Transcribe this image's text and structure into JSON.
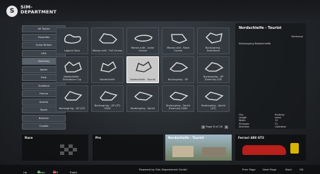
{
  "header": {
    "logo_letter": "S",
    "brand_line1": "SIM-",
    "brand_line2": "DEPARTMENT"
  },
  "nav": {
    "items": [
      "All Tracks",
      "Favorites",
      "Great Britain",
      "USA",
      "Germany",
      "Japan",
      "Italy",
      "Scotland",
      "France",
      "Austria",
      "Spain",
      "Bahrain",
      "Croatia"
    ]
  },
  "tracks": [
    {
      "label": "Laguna Seca"
    },
    {
      "label": "Monza cutit - Full Course"
    },
    {
      "label": "Monza cutit - Junior Course"
    },
    {
      "label": "Monza cutit - Road Course"
    },
    {
      "label": "Nurburgring - Endurance"
    },
    {
      "label": "Nordschleife - Endurance Cup"
    },
    {
      "label": "Nordschleife"
    },
    {
      "label": "Nordschleife - Tourist"
    },
    {
      "label": "Nurburgring - GP"
    },
    {
      "label": "Nurburgring - GP (Formula) (GP)"
    },
    {
      "label": "Nurburgring - GP (GT)"
    },
    {
      "label": "Nurburgring - GP (GT) OSAV"
    },
    {
      "label": "Nurburgring - Sprint"
    },
    {
      "label": "Nurburgring - Sprint (Formula) OSAV"
    },
    {
      "label": "Nurburgring - Sprint (GT)"
    }
  ],
  "pager": {
    "text": "Page 6 of 18"
  },
  "info": {
    "title": "Nordschleife - Tourist",
    "country": "Germany",
    "track": "Nurburgring Nordschleife",
    "stats": [
      {
        "k": "City",
        "v": "Nurburg"
      },
      {
        "k": "Length",
        "v": "same"
      },
      {
        "k": "Width",
        "v": "15"
      },
      {
        "k": "Pit boxes",
        "v": "31"
      },
      {
        "k": "Direction",
        "v": "clockwise"
      }
    ]
  },
  "panels": {
    "race": "Race",
    "pro": "Pro",
    "track_preview": "Nordschleife - Tourist",
    "car": "Ferrari 488 GT3"
  },
  "footer": {
    "up": "Up",
    "down": "Down",
    "left": "Left",
    "right": "Right",
    "powered": "Powered by Sim-Department GmbH",
    "prev": "Prev Page",
    "next": "Next Page",
    "back": "Back",
    "ok": "OK"
  },
  "colors": {
    "accent_red": "#c9302c",
    "accent_green": "#3fa34d",
    "accent_yellow": "#d8b500"
  }
}
